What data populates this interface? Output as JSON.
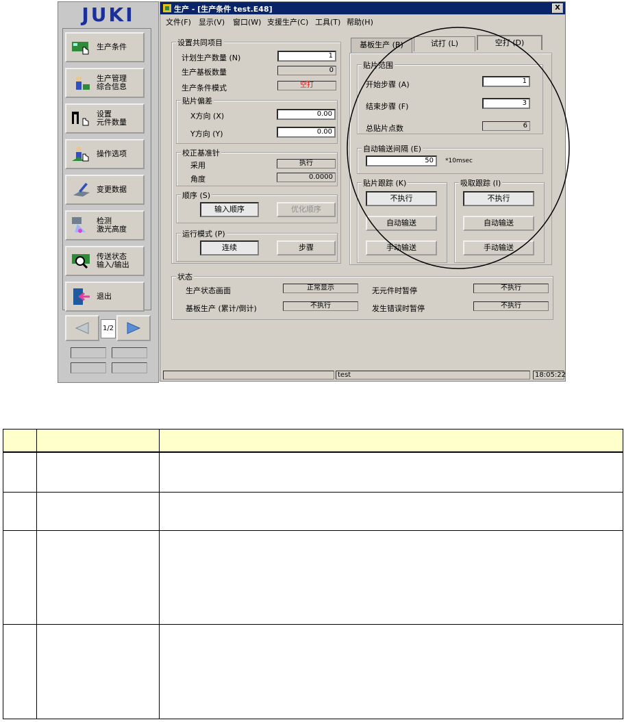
{
  "left_panel": {
    "logo": "JUKI",
    "items": [
      {
        "label": "生产条件",
        "icon": "pcb-hand-icon"
      },
      {
        "label": "生产管理\n综合信息",
        "icon": "operator-icon"
      },
      {
        "label": "设置\n元件数量",
        "icon": "component-hand-icon"
      },
      {
        "label": "操作选项",
        "icon": "operator-option-icon"
      },
      {
        "label": "变更数据",
        "icon": "edit-data-icon"
      },
      {
        "label": "检测\n激光高度",
        "icon": "laser-icon"
      },
      {
        "label": "传送状态\n输入/输出",
        "icon": "io-magnifier-icon"
      },
      {
        "label": "退出",
        "icon": "exit-door-icon"
      }
    ],
    "pager": {
      "prev_icon": "left-arrow-icon",
      "page": "1/2",
      "next_icon": "right-arrow-icon"
    }
  },
  "window": {
    "title": "生产 - [生产条件 test.E48]",
    "close_label": "X",
    "menu": [
      "文件(F)",
      "显示(V)",
      "窗口(W)",
      "支援生产(C)",
      "工具(T)",
      "帮助(H)"
    ],
    "common": {
      "title": "设置共同项目",
      "plan_qty_label": "计划生产数量 (N)",
      "plan_qty": "1",
      "board_qty_label": "生产基板数量",
      "board_qty": "0",
      "mode_label": "生产条件模式",
      "mode_value": "空打",
      "offset_title": "贴片偏差",
      "x_label": "X方向 (X)",
      "x_value": "0.00",
      "y_label": "Y方向 (Y)",
      "y_value": "0.00",
      "pin_title": "校正基准针",
      "adopt_label": "采用",
      "adopt_value": "执行",
      "angle_label": "角度",
      "angle_value": "0.0000",
      "order_title": "顺序 (S)",
      "order_input": "输入顺序",
      "order_opt": "优化顺序",
      "run_title": "运行模式 (P)",
      "run_cont": "连续",
      "run_step": "步骤"
    },
    "tabs": [
      "基板生产 (B)",
      "试打 (L)",
      "空打 (D)"
    ],
    "dry": {
      "range_title": "贴片范围",
      "start_label": "开始步骤 (A)",
      "start_value": "1",
      "end_label": "结束步骤 (F)",
      "end_value": "3",
      "total_label": "总贴片点数",
      "total_value": "6",
      "interval_title": "自动输送间隔 (E)",
      "interval_value": "50",
      "interval_unit": "*10msec",
      "trace_title": "贴片跟踪 (K)",
      "pick_title": "吸取跟踪 (I)",
      "btn_none": "不执行",
      "btn_auto": "自动输送",
      "btn_manual": "手动输送"
    },
    "status": {
      "title": "状态",
      "screen_label": "生产状态画面",
      "screen_value": "正常显示",
      "nocomp_label": "无元件时暂停",
      "nocomp_value": "不执行",
      "board_label": "基板生产 (累计/倒计)",
      "board_value": "不执行",
      "error_label": "发生错误时暂停",
      "error_value": "不执行"
    },
    "statusbar": {
      "file": "test",
      "time": "18:05:22"
    }
  },
  "colors": {
    "title_bar": "#0a246a",
    "mode_text": "#ff0000",
    "logo": "#1b2f9c",
    "table_header": "#ffffcc"
  }
}
